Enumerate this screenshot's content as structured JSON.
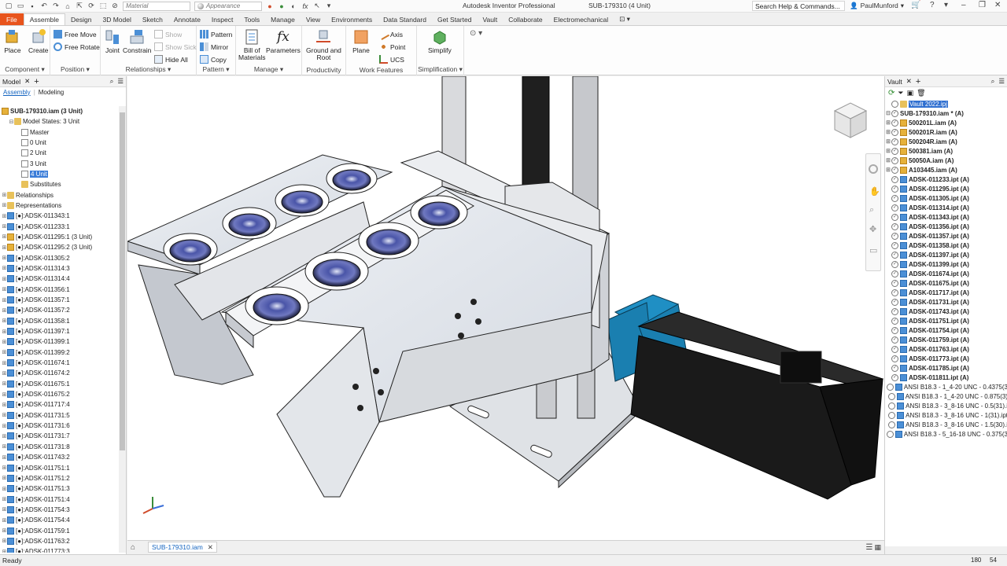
{
  "titlebar": {
    "material_label": "Material",
    "appearance_label": "Appearance",
    "app_title": "Autodesk Inventor Professional",
    "doc_title": "SUB-179310 (4 Unit)",
    "search_placeholder": "Search Help & Commands...",
    "user": "PaulMunford"
  },
  "ribbon_tabs": [
    "File",
    "Assemble",
    "Design",
    "3D Model",
    "Sketch",
    "Annotate",
    "Inspect",
    "Tools",
    "Manage",
    "View",
    "Environments",
    "Data Standard",
    "Get Started",
    "Vault",
    "Collaborate",
    "Electromechanical"
  ],
  "ribbon": {
    "component": {
      "label": "Component",
      "place": "Place",
      "create": "Create"
    },
    "position": {
      "label": "Position",
      "free_move": "Free Move",
      "free_rotate": "Free Rotate"
    },
    "relationships": {
      "label": "Relationships",
      "joint": "Joint",
      "constrain": "Constrain",
      "show": "Show",
      "show_sick": "Show Sick",
      "hide_all": "Hide All"
    },
    "pattern": {
      "label": "Pattern",
      "pattern": "Pattern",
      "mirror": "Mirror",
      "copy": "Copy"
    },
    "manage": {
      "label": "Manage",
      "bom_1": "Bill of",
      "bom_2": "Materials",
      "parameters": "Parameters"
    },
    "productivity": {
      "label": "Productivity",
      "ground_1": "Ground and",
      "ground_2": "Root"
    },
    "work_features": {
      "label": "Work Features",
      "plane": "Plane",
      "axis": "Axis",
      "point": "Point",
      "ucs": "UCS"
    },
    "simplification": {
      "label": "Simplification",
      "simplify": "Simplify"
    }
  },
  "browser": {
    "tab_model": "Model",
    "sub_assembly": "Assembly",
    "sub_modeling": "Modeling",
    "root": "SUB-179310.iam (3 Unit)",
    "nodes": [
      {
        "label": "Model States: 3 Unit",
        "indent": 1,
        "icon": "folder",
        "tw": "⊟"
      },
      {
        "label": "Master",
        "indent": 2,
        "icon": "state",
        "tw": ""
      },
      {
        "label": "0 Unit",
        "indent": 2,
        "icon": "state",
        "tw": ""
      },
      {
        "label": "2 Unit",
        "indent": 2,
        "icon": "state",
        "tw": ""
      },
      {
        "label": "3 Unit",
        "indent": 2,
        "icon": "state",
        "tw": ""
      },
      {
        "label": "4 Unit",
        "indent": 2,
        "icon": "state",
        "tw": "",
        "selected": true
      },
      {
        "label": "Substitutes",
        "indent": 2,
        "icon": "folder",
        "tw": ""
      },
      {
        "label": "Relationships",
        "indent": 0,
        "icon": "folder",
        "tw": "⊞"
      },
      {
        "label": "Representations",
        "indent": 0,
        "icon": "folder",
        "tw": "⊞"
      },
      {
        "label": "[●]:ADSK-011343:1",
        "indent": 0,
        "icon": "part",
        "tw": "⊞"
      },
      {
        "label": "[●]:ADSK-011233:1",
        "indent": 0,
        "icon": "part",
        "tw": "⊞"
      },
      {
        "label": "[●]:ADSK-011295:1 (3 Unit)",
        "indent": 0,
        "icon": "asm",
        "tw": "⊞"
      },
      {
        "label": "[●]:ADSK-011295:2 (3 Unit)",
        "indent": 0,
        "icon": "asm",
        "tw": "⊞"
      },
      {
        "label": "[●]:ADSK-011305:2",
        "indent": 0,
        "icon": "part",
        "tw": "⊞"
      },
      {
        "label": "[●]:ADSK-011314:3",
        "indent": 0,
        "icon": "part",
        "tw": "⊞"
      },
      {
        "label": "[●]:ADSK-011314:4",
        "indent": 0,
        "icon": "part",
        "tw": "⊞"
      },
      {
        "label": "[●]:ADSK-011356:1",
        "indent": 0,
        "icon": "part",
        "tw": "⊞"
      },
      {
        "label": "[●]:ADSK-011357:1",
        "indent": 0,
        "icon": "part",
        "tw": "⊞"
      },
      {
        "label": "[●]:ADSK-011357:2",
        "indent": 0,
        "icon": "part",
        "tw": "⊞"
      },
      {
        "label": "[●]:ADSK-011358:1",
        "indent": 0,
        "icon": "part",
        "tw": "⊞"
      },
      {
        "label": "[●]:ADSK-011397:1",
        "indent": 0,
        "icon": "part",
        "tw": "⊞"
      },
      {
        "label": "[●]:ADSK-011399:1",
        "indent": 0,
        "icon": "part",
        "tw": "⊞"
      },
      {
        "label": "[●]:ADSK-011399:2",
        "indent": 0,
        "icon": "part",
        "tw": "⊞"
      },
      {
        "label": "[●]:ADSK-011674:1",
        "indent": 0,
        "icon": "part",
        "tw": "⊞"
      },
      {
        "label": "[●]:ADSK-011674:2",
        "indent": 0,
        "icon": "part",
        "tw": "⊞"
      },
      {
        "label": "[●]:ADSK-011675:1",
        "indent": 0,
        "icon": "part",
        "tw": "⊞"
      },
      {
        "label": "[●]:ADSK-011675:2",
        "indent": 0,
        "icon": "part",
        "tw": "⊞"
      },
      {
        "label": "[●]:ADSK-011717:4",
        "indent": 0,
        "icon": "part",
        "tw": "⊞"
      },
      {
        "label": "[●]:ADSK-011731:5",
        "indent": 0,
        "icon": "part",
        "tw": "⊞"
      },
      {
        "label": "[●]:ADSK-011731:6",
        "indent": 0,
        "icon": "part",
        "tw": "⊞"
      },
      {
        "label": "[●]:ADSK-011731:7",
        "indent": 0,
        "icon": "part",
        "tw": "⊞"
      },
      {
        "label": "[●]:ADSK-011731:8",
        "indent": 0,
        "icon": "part",
        "tw": "⊞"
      },
      {
        "label": "[●]:ADSK-011743:2",
        "indent": 0,
        "icon": "part",
        "tw": "⊞"
      },
      {
        "label": "[●]:ADSK-011751:1",
        "indent": 0,
        "icon": "part",
        "tw": "⊞"
      },
      {
        "label": "[●]:ADSK-011751:2",
        "indent": 0,
        "icon": "part",
        "tw": "⊞"
      },
      {
        "label": "[●]:ADSK-011751:3",
        "indent": 0,
        "icon": "part",
        "tw": "⊞"
      },
      {
        "label": "[●]:ADSK-011751:4",
        "indent": 0,
        "icon": "part",
        "tw": "⊞"
      },
      {
        "label": "[●]:ADSK-011754:3",
        "indent": 0,
        "icon": "part",
        "tw": "⊞"
      },
      {
        "label": "[●]:ADSK-011754:4",
        "indent": 0,
        "icon": "part",
        "tw": "⊞"
      },
      {
        "label": "[●]:ADSK-011759:1",
        "indent": 0,
        "icon": "part",
        "tw": "⊞"
      },
      {
        "label": "[●]:ADSK-011763:2",
        "indent": 0,
        "icon": "part",
        "tw": "⊞"
      },
      {
        "label": "[●]:ADSK-011773:3",
        "indent": 0,
        "icon": "part",
        "tw": "⊞"
      }
    ]
  },
  "vault": {
    "tab": "Vault",
    "items": [
      {
        "label": "Vault 2022.ipj",
        "tw": "",
        "icon": "folder",
        "bold": false,
        "hl": true
      },
      {
        "label": "SUB-179310.iam * (A)",
        "tw": "⊟",
        "icon": "none",
        "bold": true
      },
      {
        "label": "500201L.iam (A)",
        "tw": "⊞",
        "icon": "asm",
        "bold": true
      },
      {
        "label": "500201R.iam (A)",
        "tw": "⊞",
        "icon": "asm",
        "bold": true
      },
      {
        "label": "500204R.iam (A)",
        "tw": "⊞",
        "icon": "asm",
        "bold": true
      },
      {
        "label": "500381.iam (A)",
        "tw": "⊞",
        "icon": "asm",
        "bold": true
      },
      {
        "label": "50050A.iam (A)",
        "tw": "⊞",
        "icon": "asm",
        "bold": true
      },
      {
        "label": "A103445.iam (A)",
        "tw": "⊞",
        "icon": "asm",
        "bold": true
      },
      {
        "label": "ADSK-011233.ipt (A)",
        "tw": "",
        "icon": "part",
        "bold": true
      },
      {
        "label": "ADSK-011295.ipt (A)",
        "tw": "",
        "icon": "part",
        "bold": true
      },
      {
        "label": "ADSK-011305.ipt (A)",
        "tw": "",
        "icon": "part",
        "bold": true
      },
      {
        "label": "ADSK-011314.ipt (A)",
        "tw": "",
        "icon": "part",
        "bold": true
      },
      {
        "label": "ADSK-011343.ipt (A)",
        "tw": "",
        "icon": "part",
        "bold": true
      },
      {
        "label": "ADSK-011356.ipt (A)",
        "tw": "",
        "icon": "part",
        "bold": true
      },
      {
        "label": "ADSK-011357.ipt (A)",
        "tw": "",
        "icon": "part",
        "bold": true
      },
      {
        "label": "ADSK-011358.ipt (A)",
        "tw": "",
        "icon": "part",
        "bold": true
      },
      {
        "label": "ADSK-011397.ipt (A)",
        "tw": "",
        "icon": "part",
        "bold": true
      },
      {
        "label": "ADSK-011399.ipt (A)",
        "tw": "",
        "icon": "part",
        "bold": true
      },
      {
        "label": "ADSK-011674.ipt (A)",
        "tw": "",
        "icon": "part",
        "bold": true
      },
      {
        "label": "ADSK-011675.ipt (A)",
        "tw": "",
        "icon": "part",
        "bold": true
      },
      {
        "label": "ADSK-011717.ipt (A)",
        "tw": "",
        "icon": "part",
        "bold": true
      },
      {
        "label": "ADSK-011731.ipt (A)",
        "tw": "",
        "icon": "part",
        "bold": true
      },
      {
        "label": "ADSK-011743.ipt (A)",
        "tw": "",
        "icon": "part",
        "bold": true
      },
      {
        "label": "ADSK-011751.ipt (A)",
        "tw": "",
        "icon": "part",
        "bold": true
      },
      {
        "label": "ADSK-011754.ipt (A)",
        "tw": "",
        "icon": "part",
        "bold": true
      },
      {
        "label": "ADSK-011759.ipt (A)",
        "tw": "",
        "icon": "part",
        "bold": true
      },
      {
        "label": "ADSK-011763.ipt (A)",
        "tw": "",
        "icon": "part",
        "bold": true
      },
      {
        "label": "ADSK-011773.ipt (A)",
        "tw": "",
        "icon": "part",
        "bold": true
      },
      {
        "label": "ADSK-011785.ipt (A)",
        "tw": "",
        "icon": "part",
        "bold": true
      },
      {
        "label": "ADSK-011811.ipt (A)",
        "tw": "",
        "icon": "part",
        "bold": true
      },
      {
        "label": "ANSI B18.3 - 1_4-20 UNC - 0.4375(3",
        "tw": "",
        "icon": "part",
        "bold": false
      },
      {
        "label": "ANSI B18.3 - 1_4-20 UNC - 0.875(3)",
        "tw": "",
        "icon": "part",
        "bold": false
      },
      {
        "label": "ANSI B18.3 - 3_8-16 UNC - 0.5(31).i",
        "tw": "",
        "icon": "part",
        "bold": false
      },
      {
        "label": "ANSI B18.3 - 3_8-16 UNC - 1(31).ipt",
        "tw": "",
        "icon": "part",
        "bold": false
      },
      {
        "label": "ANSI B18.3 - 3_8-16 UNC - 1.5(30).i",
        "tw": "",
        "icon": "part",
        "bold": false
      },
      {
        "label": "ANSI B18.3 - 5_16-18 UNC - 0.375(3",
        "tw": "",
        "icon": "part",
        "bold": false
      }
    ]
  },
  "doc_tab": "SUB-179310.iam",
  "status": {
    "text": "Ready",
    "n1": "180",
    "n2": "54"
  },
  "colors": {
    "accent": "#e8541c",
    "select": "#3b7dd8",
    "motor": "#1f8fc4"
  }
}
